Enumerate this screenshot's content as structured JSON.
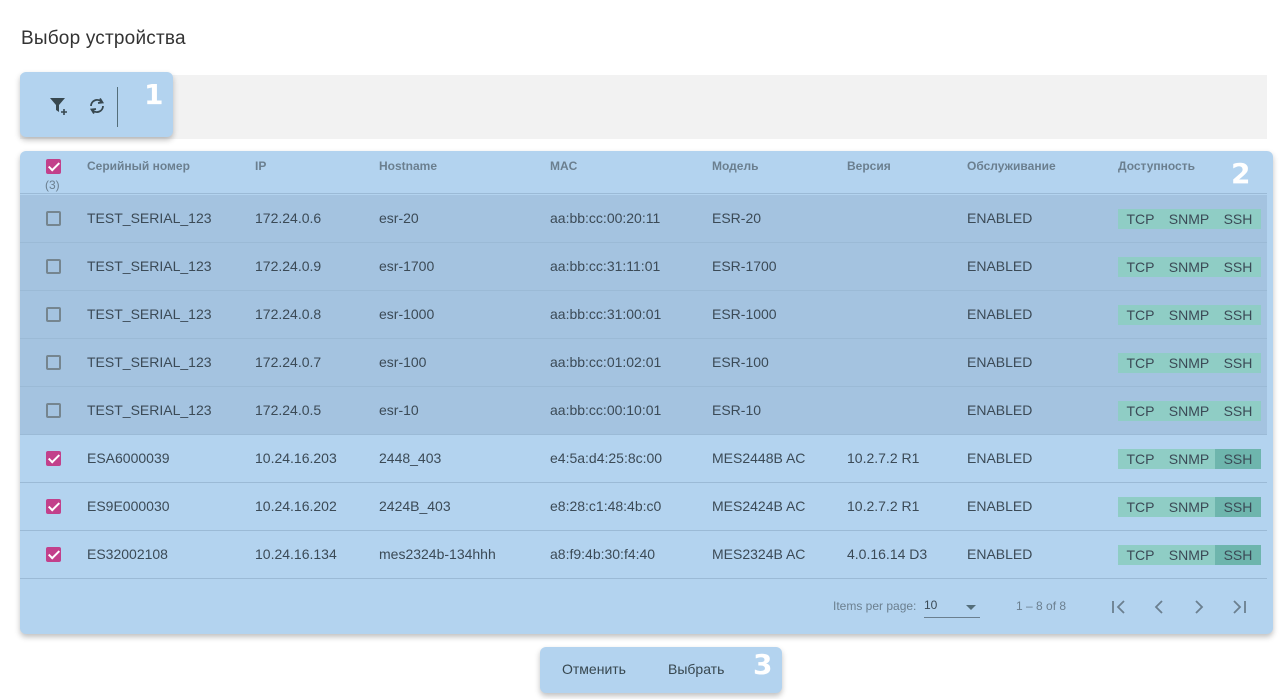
{
  "page": {
    "title": "Выбор устройства"
  },
  "markers": [
    "1",
    "2",
    "3"
  ],
  "toolbar": {
    "icons": [
      "filter-add-icon",
      "refresh-icon"
    ]
  },
  "table": {
    "columns": [
      "Серийный номер",
      "IP",
      "Hostname",
      "MAC",
      "Модель",
      "Версия",
      "Обслуживание",
      "Доступность"
    ],
    "selected_count": "(3)",
    "protocols": [
      "TCP",
      "SNMP",
      "SSH"
    ],
    "rows": [
      {
        "selected": false,
        "serial": "TEST_SERIAL_123",
        "ip": "172.24.0.6",
        "hostname": "esr-20",
        "mac": "aa:bb:cc:00:20:11",
        "model": "ESR-20",
        "version": "",
        "service": "ENABLED"
      },
      {
        "selected": false,
        "serial": "TEST_SERIAL_123",
        "ip": "172.24.0.9",
        "hostname": "esr-1700",
        "mac": "aa:bb:cc:31:11:01",
        "model": "ESR-1700",
        "version": "",
        "service": "ENABLED"
      },
      {
        "selected": false,
        "serial": "TEST_SERIAL_123",
        "ip": "172.24.0.8",
        "hostname": "esr-1000",
        "mac": "aa:bb:cc:31:00:01",
        "model": "ESR-1000",
        "version": "",
        "service": "ENABLED"
      },
      {
        "selected": false,
        "serial": "TEST_SERIAL_123",
        "ip": "172.24.0.7",
        "hostname": "esr-100",
        "mac": "aa:bb:cc:01:02:01",
        "model": "ESR-100",
        "version": "",
        "service": "ENABLED"
      },
      {
        "selected": false,
        "serial": "TEST_SERIAL_123",
        "ip": "172.24.0.5",
        "hostname": "esr-10",
        "mac": "aa:bb:cc:00:10:01",
        "model": "ESR-10",
        "version": "",
        "service": "ENABLED"
      },
      {
        "selected": true,
        "serial": "ESA6000039",
        "ip": "10.24.16.203",
        "hostname": "2448_403",
        "mac": "e4:5a:d4:25:8c:00",
        "model": "MES2448B AC",
        "version": "10.2.7.2 R1",
        "service": "ENABLED"
      },
      {
        "selected": true,
        "serial": "ES9E000030",
        "ip": "10.24.16.202",
        "hostname": "2424B_403",
        "mac": "e8:28:c1:48:4b:c0",
        "model": "MES2424B AC",
        "version": "10.2.7.2 R1",
        "service": "ENABLED"
      },
      {
        "selected": true,
        "serial": "ES32002108",
        "ip": "10.24.16.134",
        "hostname": "mes2324b-134hhh",
        "mac": "a8:f9:4b:30:f4:40",
        "model": "MES2324B AC",
        "version": "4.0.16.14 D3",
        "service": "ENABLED"
      }
    ]
  },
  "pagination": {
    "items_per_page_label": "Items per page:",
    "items_per_page": "10",
    "range": "1 – 8 of 8",
    "buttons": [
      "first-page-icon",
      "prev-page-icon",
      "next-page-icon",
      "last-page-icon"
    ]
  },
  "actions": {
    "cancel": "Отменить",
    "select": "Выбрать"
  },
  "colors": {
    "panel": "#b3d3ef",
    "checkbox": "#c2408b",
    "protocol": "#8fcdc5",
    "protocol_active": "#6eb5ad"
  }
}
